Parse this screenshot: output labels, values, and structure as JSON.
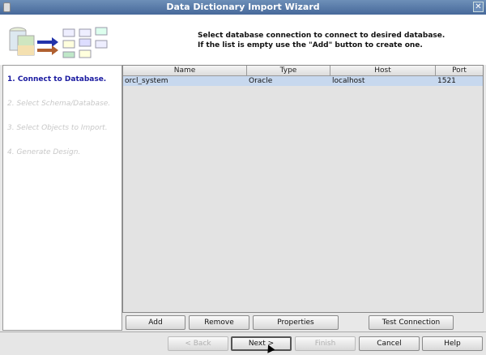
{
  "window": {
    "title": "Data Dictionary Import Wizard"
  },
  "header": {
    "line1": "Select database connection to connect to desired database.",
    "line2": "If the list is empty use the \"Add\" button to create one."
  },
  "steps": [
    "1. Connect to Database.",
    "2. Select Schema/Database.",
    "3. Select Objects to Import.",
    "4. Generate Design."
  ],
  "table": {
    "columns": [
      "Name",
      "Type",
      "Host",
      "Port"
    ],
    "rows": [
      [
        "orcl_system",
        "Oracle",
        "localhost",
        "1521"
      ]
    ]
  },
  "actions": {
    "add": "Add",
    "remove": "Remove",
    "properties": "Properties",
    "test": "Test Connection"
  },
  "nav": {
    "back": "< Back",
    "next": "Next >",
    "finish": "Finish",
    "cancel": "Cancel",
    "help": "Help"
  }
}
